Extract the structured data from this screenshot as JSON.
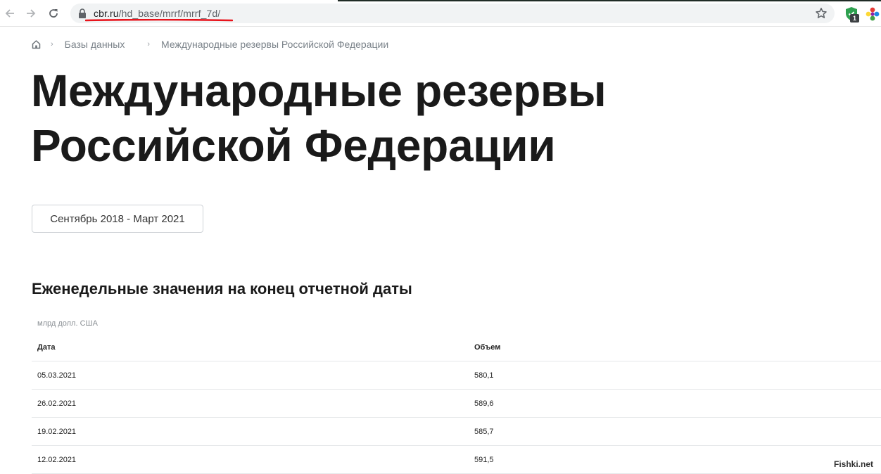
{
  "browser": {
    "url_host": "cbr.ru",
    "url_path": "/hd_base/mrrf/mrrf_7d/",
    "extension_badge": "1"
  },
  "breadcrumb": {
    "items": [
      "Базы данных",
      "Международные резервы Российской Федерации"
    ]
  },
  "page": {
    "title": "Международные резервы Российской Федерации",
    "period_button": "Сентябрь 2018 - Март 2021",
    "section_title": "Еженедельные значения на конец отчетной даты",
    "units": "млрд долл. США"
  },
  "table": {
    "headers": [
      "Дата",
      "Объем"
    ],
    "rows": [
      [
        "05.03.2021",
        "580,1"
      ],
      [
        "26.02.2021",
        "589,6"
      ],
      [
        "19.02.2021",
        "585,7"
      ],
      [
        "12.02.2021",
        "591,5"
      ]
    ]
  },
  "watermark": "Fishki.net",
  "colors": {
    "url_underline": "#e8141c",
    "extension_shield": "#2ea04f"
  }
}
